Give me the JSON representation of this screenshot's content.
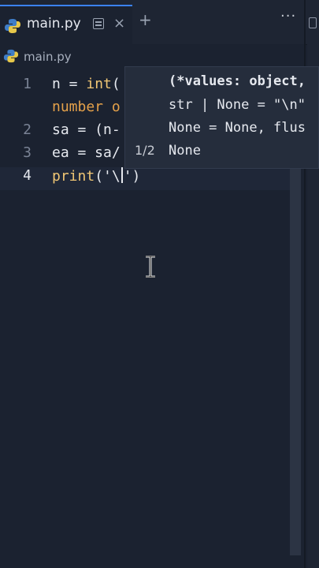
{
  "tab": {
    "label": "main.py",
    "active": true
  },
  "breadcrumb": {
    "file": "main.py"
  },
  "code_lines": [
    {
      "num": "1",
      "tokens": [
        [
          "n = ",
          "plain"
        ],
        [
          "int",
          "kw"
        ],
        [
          "(",
          "plain"
        ]
      ]
    },
    {
      "num": "",
      "tokens": [
        [
          "number o",
          "hint"
        ]
      ]
    },
    {
      "num": "2",
      "tokens": [
        [
          "sa = (n-",
          "plain"
        ]
      ]
    },
    {
      "num": "3",
      "tokens": [
        [
          "ea = sa/",
          "plain"
        ]
      ]
    },
    {
      "num": "4",
      "tokens": [
        [
          "print",
          "kw"
        ],
        [
          "('\\",
          "plain"
        ]
      ],
      "after_caret": "')"
    }
  ],
  "hover": {
    "counter": "1/2",
    "lines": [
      "(*values: object,",
      "str | None = \"\\n\"",
      "None = None, flus",
      "None"
    ]
  },
  "colors": {
    "accent": "#3b82f6",
    "background": "#1b2230",
    "keyword": "#f0c674"
  }
}
